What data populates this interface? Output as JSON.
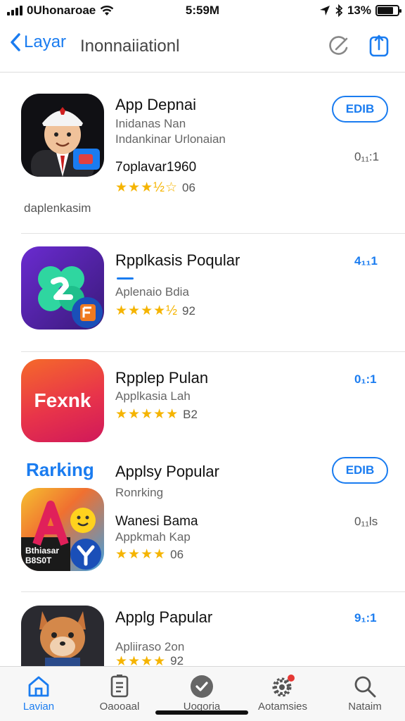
{
  "status_bar": {
    "carrier": "0Uhonaroae",
    "time": "5:59M",
    "battery_pct": "13%"
  },
  "nav": {
    "back_label": "Layar",
    "title": "Inonnaiiationl"
  },
  "apps": [
    {
      "title": "App Depnai",
      "subtitle": "Inidanas Nan",
      "subtitle2": "Indankinar Urlonaian",
      "developer": "7oplavar1960",
      "stars": "★★★½☆",
      "rating": "06",
      "side": "0₁₁:1",
      "action": "EDIB",
      "caption": "daplenkasim"
    },
    {
      "title": "Rpplkasis Poqular",
      "subtitle": "Aplenaio Bdia",
      "stars": "★★★★½",
      "rating": "92",
      "side": "4₁₁1"
    },
    {
      "title": "Rpplep Pulan",
      "subtitle": "Applkasia Lah",
      "stars": "★★★★★",
      "rating": "B2",
      "side": "0₁:1",
      "icon_text": "Fexnk"
    },
    {
      "section": "Rarking",
      "title": "Applsy Popular",
      "subtitle": "Ronrking",
      "developer": "Wanesi Bama",
      "subtitle2": "Appkmah Kap",
      "stars": "★★★★",
      "rating": "06",
      "side": "0₁₁ls",
      "action": "EDIB",
      "icon_overlay": "Bthiasar\nB8S0T"
    },
    {
      "title": "Applg Papular",
      "subtitle": "Apliiraso 2on",
      "stars": "★★★★",
      "rating": "92",
      "side": "9₁:1"
    }
  ],
  "tabs": [
    {
      "label": "Lavian",
      "icon": "home-icon",
      "active": true
    },
    {
      "label": "Oaooaal",
      "icon": "document-icon"
    },
    {
      "label": "Uogoria",
      "icon": "check-circle-icon"
    },
    {
      "label": "Aotamsies",
      "icon": "gear-icon"
    },
    {
      "label": "Nataim",
      "icon": "search-icon"
    }
  ],
  "colors": {
    "accent": "#1a7cf0",
    "star": "#f5b400"
  }
}
